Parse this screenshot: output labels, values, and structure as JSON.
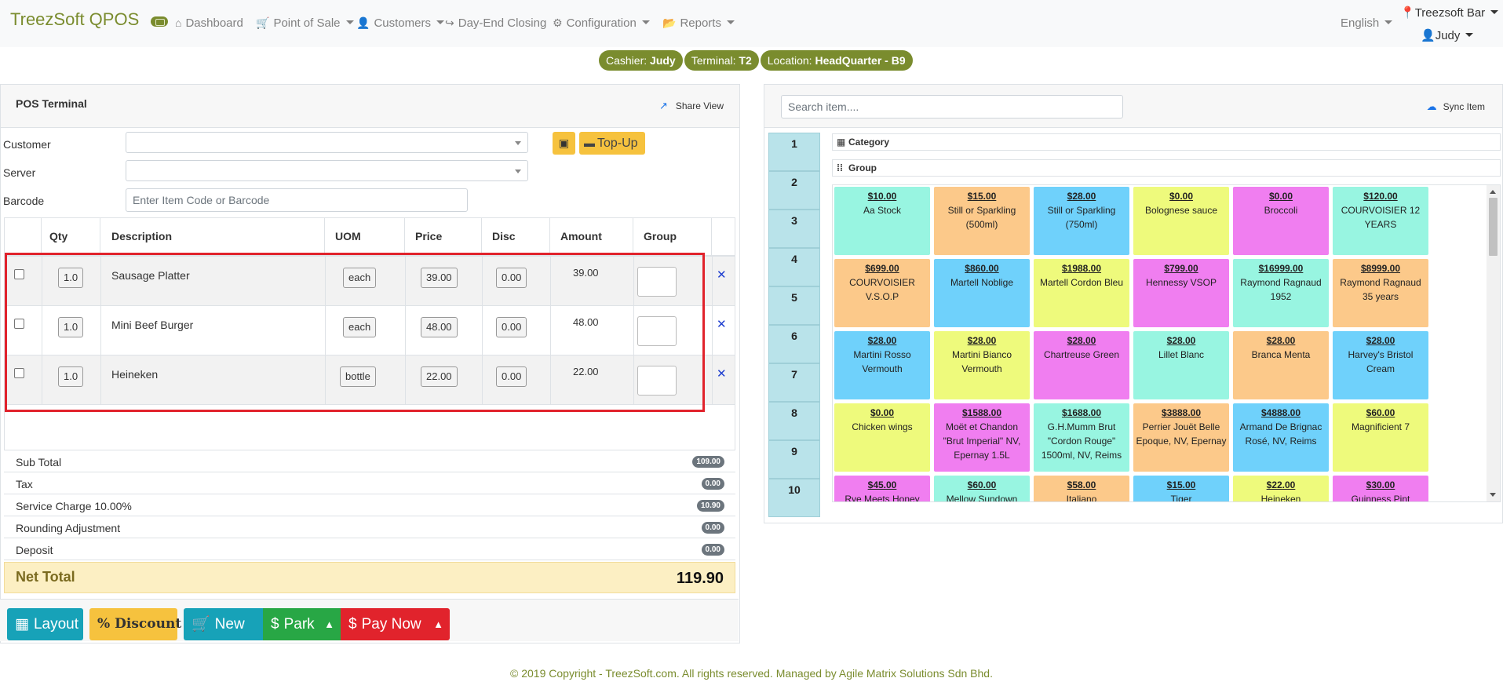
{
  "navbar": {
    "brand": "TreezSoft QPOS",
    "items": [
      {
        "label": "Dashboard",
        "icon": "home-icon",
        "glyph": "⌂"
      },
      {
        "label": "Point of Sale",
        "icon": "cart-icon",
        "glyph": "🛒"
      },
      {
        "label": "Customers",
        "icon": "user-icon",
        "glyph": "👤"
      },
      {
        "label": "Day-End Closing",
        "icon": "share-icon",
        "glyph": "↪"
      },
      {
        "label": "Configuration",
        "icon": "gear-icon",
        "glyph": "⚙"
      },
      {
        "label": "Reports",
        "icon": "folder-icon",
        "glyph": "📂"
      }
    ],
    "language": "English",
    "outlet": "Treezsoft Bar",
    "user": "Judy"
  },
  "status": {
    "cashier_label": "Cashier:",
    "cashier": "Judy",
    "terminal_label": "Terminal:",
    "terminal": "T2",
    "location_label": "Location:",
    "location": "HeadQuarter - B9"
  },
  "pos": {
    "title": "POS Terminal",
    "share_view": "Share View",
    "customer_label": "Customer",
    "server_label": "Server",
    "barcode_label": "Barcode",
    "barcode_placeholder": "Enter Item Code or Barcode",
    "topup": "Top-Up",
    "columns": [
      "Qty",
      "Description",
      "UOM",
      "Price",
      "Disc",
      "Amount",
      "Group"
    ],
    "lines": [
      {
        "qty": "1.0",
        "desc": "Sausage Platter",
        "uom": "each",
        "price": "39.00",
        "disc": "0.00",
        "amount": "39.00"
      },
      {
        "qty": "1.0",
        "desc": "Mini Beef Burger",
        "uom": "each",
        "price": "48.00",
        "disc": "0.00",
        "amount": "48.00"
      },
      {
        "qty": "1.0",
        "desc": "Heineken",
        "uom": "bottle",
        "price": "22.00",
        "disc": "0.00",
        "amount": "22.00"
      }
    ],
    "totals": [
      {
        "label": "Sub Total",
        "value": "109.00"
      },
      {
        "label": "Tax",
        "value": "0.00"
      },
      {
        "label": "Service Charge 10.00%",
        "value": "10.90"
      },
      {
        "label": "Rounding Adjustment",
        "value": "0.00"
      },
      {
        "label": "Deposit",
        "value": "0.00"
      }
    ],
    "net_label": "Net Total",
    "net_value": "119.90",
    "buttons": {
      "layout": "Layout",
      "discount": "Discount",
      "new": "New",
      "park": "Park",
      "pay": "Pay Now"
    }
  },
  "items_panel": {
    "search_placeholder": "Search item....",
    "sync": "Sync Item",
    "category": "Category",
    "group": "Group",
    "pages": [
      "1",
      "2",
      "3",
      "4",
      "5",
      "6",
      "7",
      "8",
      "9",
      "10"
    ],
    "tiles": [
      {
        "price": "$10.00",
        "name": "Aa Stock",
        "color": "#98f5e1"
      },
      {
        "price": "$15.00",
        "name": "Still or Sparkling (500ml)",
        "color": "#fcc98a"
      },
      {
        "price": "$28.00",
        "name": "Still or Sparkling (750ml)",
        "color": "#6fd1fb"
      },
      {
        "price": "$0.00",
        "name": "Bolognese sauce",
        "color": "#eefa7c"
      },
      {
        "price": "$0.00",
        "name": "Broccoli",
        "color": "#f07ef0"
      },
      {
        "price": "$120.00",
        "name": "COURVOISIER 12 YEARS",
        "color": "#98f5e1"
      },
      {
        "price": "$699.00",
        "name": "COURVOISIER V.S.O.P",
        "color": "#fcc98a"
      },
      {
        "price": "$860.00",
        "name": "Martell Noblige",
        "color": "#6fd1fb"
      },
      {
        "price": "$1988.00",
        "name": "Martell Cordon Bleu",
        "color": "#eefa7c"
      },
      {
        "price": "$799.00",
        "name": "Hennessy VSOP",
        "color": "#f07ef0"
      },
      {
        "price": "$16999.00",
        "name": "Raymond Ragnaud 1952",
        "color": "#98f5e1"
      },
      {
        "price": "$8999.00",
        "name": "Raymond Ragnaud 35 years",
        "color": "#fcc98a"
      },
      {
        "price": "$28.00",
        "name": "Martini Rosso Vermouth",
        "color": "#6fd1fb"
      },
      {
        "price": "$28.00",
        "name": "Martini Bianco Vermouth",
        "color": "#eefa7c"
      },
      {
        "price": "$28.00",
        "name": "Chartreuse Green",
        "color": "#f07ef0"
      },
      {
        "price": "$28.00",
        "name": "Lillet Blanc",
        "color": "#98f5e1"
      },
      {
        "price": "$28.00",
        "name": "Branca Menta",
        "color": "#fcc98a"
      },
      {
        "price": "$28.00",
        "name": "Harvey's Bristol Cream",
        "color": "#6fd1fb"
      },
      {
        "price": "$0.00",
        "name": "Chicken wings",
        "color": "#eefa7c"
      },
      {
        "price": "$1588.00",
        "name": "Moët et Chandon \"Brut Imperial\" NV, Epernay 1.5L",
        "color": "#f07ef0"
      },
      {
        "price": "$1688.00",
        "name": "G.H.Mumm Brut \"Cordon Rouge\" 1500ml, NV, Reims",
        "color": "#98f5e1"
      },
      {
        "price": "$3888.00",
        "name": "Perrier Jouët Belle Epoque, NV, Epernay",
        "color": "#fcc98a"
      },
      {
        "price": "$4888.00",
        "name": "Armand De Brignac Rosé, NV, Reims",
        "color": "#6fd1fb"
      },
      {
        "price": "$60.00",
        "name": "Magnificient 7",
        "color": "#eefa7c"
      },
      {
        "price": "$45.00",
        "name": "Rye Meets Honey",
        "color": "#f07ef0"
      },
      {
        "price": "$60.00",
        "name": "Mellow Sundown",
        "color": "#98f5e1"
      },
      {
        "price": "$58.00",
        "name": "Italiano",
        "color": "#fcc98a"
      },
      {
        "price": "$15.00",
        "name": "Tiger",
        "color": "#6fd1fb"
      },
      {
        "price": "$22.00",
        "name": "Heineken",
        "color": "#eefa7c"
      },
      {
        "price": "$30.00",
        "name": "Guinness Pint",
        "color": "#f07ef0"
      }
    ]
  },
  "footer": "© 2019 Copyright - TreezSoft.com. All rights reserved. Managed by Agile Matrix Solutions Sdn Bhd."
}
